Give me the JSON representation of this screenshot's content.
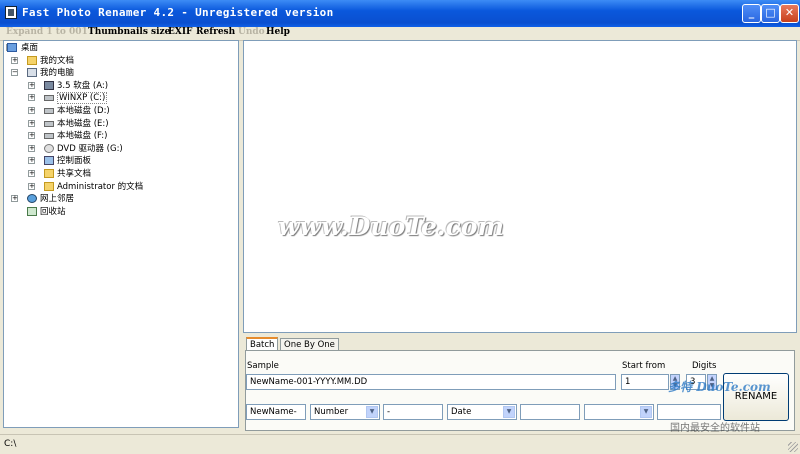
{
  "window": {
    "title": "Fast Photo Renamer 4.2 - Unregistered version"
  },
  "window_controls": {
    "minimize": "_",
    "maximize": "□",
    "close": "✕"
  },
  "menu": [
    {
      "label": "Expand 1 to 001",
      "enabled": false
    },
    {
      "label": "Thumbnails size",
      "enabled": true
    },
    {
      "label": "EXIF",
      "enabled": true
    },
    {
      "label": "Refresh",
      "enabled": true
    },
    {
      "label": "Undo",
      "enabled": false
    },
    {
      "label": "Help",
      "enabled": true
    }
  ],
  "tree": [
    {
      "label": "桌面",
      "icon": "desktop-icon",
      "level": 0,
      "expander": "−"
    },
    {
      "label": "我的文档",
      "icon": "folder-icon",
      "level": 1,
      "expander": "+"
    },
    {
      "label": "我的电脑",
      "icon": "computer-icon",
      "level": 1,
      "expander": "−"
    },
    {
      "label": "3.5 软盘 (A:)",
      "icon": "floppy-icon",
      "level": 2,
      "expander": "+"
    },
    {
      "label": "WINXP (C:)",
      "icon": "drive-icon",
      "level": 2,
      "expander": "+",
      "selected": true
    },
    {
      "label": "本地磁盘 (D:)",
      "icon": "drive-icon",
      "level": 2,
      "expander": "+"
    },
    {
      "label": "本地磁盘 (E:)",
      "icon": "drive-icon",
      "level": 2,
      "expander": "+"
    },
    {
      "label": "本地磁盘 (F:)",
      "icon": "drive-icon",
      "level": 2,
      "expander": "+"
    },
    {
      "label": "DVD 驱动器 (G:)",
      "icon": "dvd-icon",
      "level": 2,
      "expander": "+"
    },
    {
      "label": "控制面板",
      "icon": "control-panel-icon",
      "level": 2,
      "expander": "+"
    },
    {
      "label": "共享文档",
      "icon": "folder-icon",
      "level": 2,
      "expander": "+"
    },
    {
      "label": "Administrator 的文档",
      "icon": "folder-icon",
      "level": 2,
      "expander": "+"
    },
    {
      "label": "网上邻居",
      "icon": "network-icon",
      "level": 1,
      "expander": "+"
    },
    {
      "label": "回收站",
      "icon": "recycle-bin-icon",
      "level": 1,
      "expander": ""
    }
  ],
  "preview": {
    "watermark": "www.DuoTe.com"
  },
  "tabs": [
    {
      "label": "Batch",
      "active": true
    },
    {
      "label": "One By One",
      "active": false
    }
  ],
  "batch": {
    "sample_label": "Sample",
    "sample_value": "NewName-001-YYYY.MM.DD",
    "start_from_label": "Start from",
    "start_from_value": "1",
    "digits_label": "Digits",
    "digits_value": "3",
    "spin_up": "▲",
    "spin_down": "▼",
    "parts": {
      "prefix": "NewName-",
      "type1": "Number",
      "sep1": "-",
      "type2": "Date",
      "text2": "",
      "type3": "",
      "text3": ""
    },
    "drop_arrow": "▼",
    "rename_label": "RENAME"
  },
  "brand": {
    "logo_text": "多特",
    "logo_url_text": "DuoTe.com",
    "slogan": "国内最安全的软件站"
  },
  "statusbar": {
    "path": "C:\\"
  }
}
